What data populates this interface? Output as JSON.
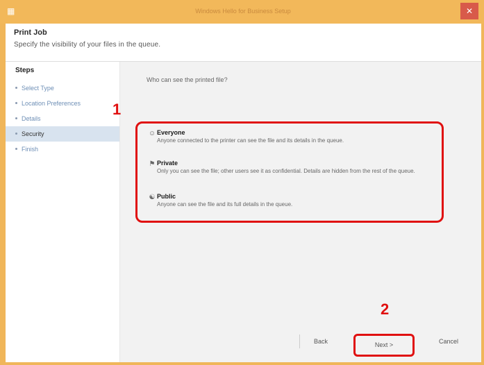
{
  "window": {
    "title": "Windows Hello for Business Setup",
    "close_label": "✕"
  },
  "header": {
    "heading": "Print Job",
    "subheading": "Specify the visibility of your files in the queue."
  },
  "sidebar": {
    "title": "Steps",
    "items": [
      {
        "label": "Select Type"
      },
      {
        "label": "Location Preferences"
      },
      {
        "label": "Details"
      },
      {
        "label": "Security"
      },
      {
        "label": "Finish"
      }
    ],
    "active_index": 3
  },
  "main": {
    "question": "Who can see the printed file?",
    "choices": [
      {
        "icon": "people-icon",
        "name": "Everyone",
        "desc": "Anyone connected to the printer can see the file and its details in the queue."
      },
      {
        "icon": "lock-icon",
        "name": "Private",
        "desc": "Only you can see the file; other users see it as confidential. Details are hidden from the rest of the queue."
      },
      {
        "icon": "globe-icon",
        "name": "Public",
        "desc": "Anyone can see the file and its full details in the queue."
      }
    ]
  },
  "markers": {
    "one": "1",
    "two": "2"
  },
  "buttons": {
    "back": "Back",
    "next": "Next >",
    "cancel": "Cancel"
  },
  "colors": {
    "titlebar": "#f2b85a",
    "highlight": "#e01010",
    "active_step": "#d8e3ef"
  }
}
